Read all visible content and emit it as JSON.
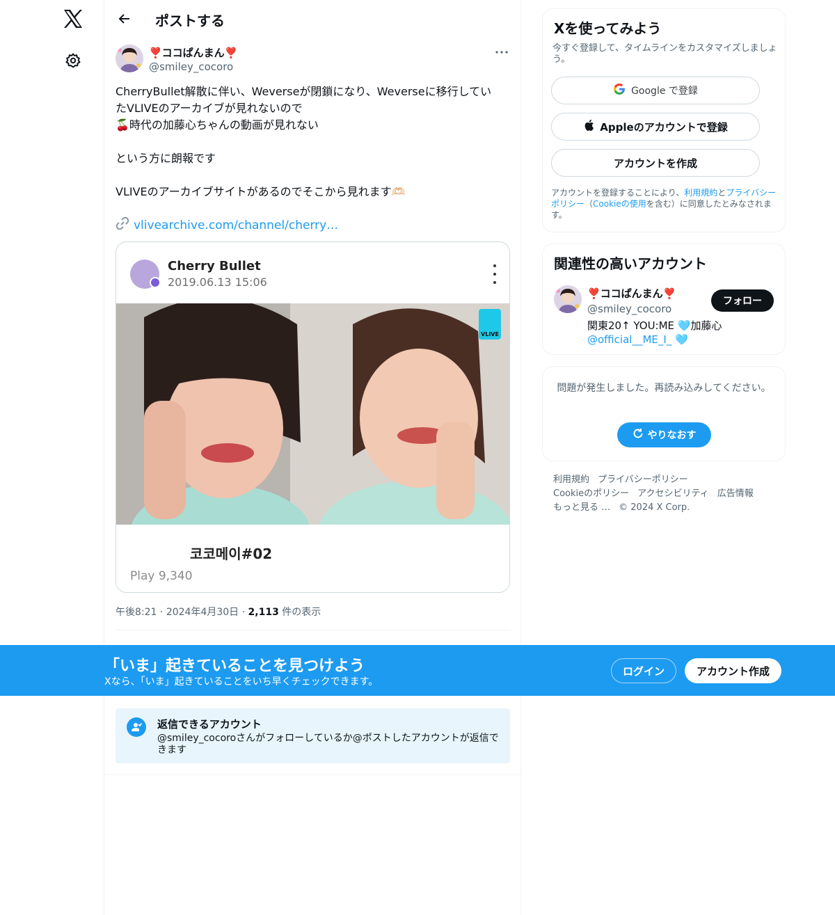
{
  "header": {
    "title": "ポストする"
  },
  "post": {
    "author_name": "❣️ココぱんまん❣️",
    "author_handle": "@smiley_cocoro",
    "text_lines": [
      "CherryBullet解散に伴い、Weverseが閉鎖になり、Weverseに移行してい",
      "たVLIVEのアーカイブが見れないので",
      "🍒時代の加藤心ちゃんの動画が見れない",
      "",
      "という方に朗報です",
      "",
      "VLIVEのアーカイブサイトがあるのでそこから見れます🫶🏻"
    ],
    "link_text": "vlivearchive.com/channel/cherry…",
    "card": {
      "channel_name": "Cherry Bullet",
      "channel_date": "2019.06.13 15:06",
      "badge_label": "VLIVE",
      "video_title": "코코메이#02",
      "plays": "Play 9,340"
    },
    "meta": {
      "time": "午後8:21",
      "date": "2024年4月30日",
      "views_count": "2,113",
      "views_label": "件の表示"
    },
    "reply_restriction": {
      "title": "返信できるアカウント",
      "description": "@smiley_cocoroさんがフォローしているか@ポストしたアカウントが返信できます"
    }
  },
  "signup_panel": {
    "title": "Xを使ってみよう",
    "subtitle": "今すぐ登録して、タイムラインをカスタマイズしましょう。",
    "google_label": "Google で登録",
    "apple_label": "Appleのアカウントで登録",
    "create_label": "アカウントを作成",
    "legal": {
      "before": "アカウントを登録することにより、",
      "terms": "利用規約",
      "and": "と",
      "privacy": "プライバシーポリシー",
      "paren_open": "（",
      "cookie": "Cookieの使用",
      "after": "を含む）に同意したとみなされます。"
    }
  },
  "related_panel": {
    "title": "関連性の高いアカウント",
    "name": "❣️ココぱんまん❣️",
    "handle": "@smiley_cocoro",
    "bio_text": "関東20↑ YOU:ME 🩵加藤心",
    "bio_mention": "@official__ME_I_",
    "bio_end": " 🩵",
    "follow_label": "フォロー"
  },
  "error_panel": {
    "message": "問題が発生しました。再読み込みしてください。",
    "retry_label": "やりなおす"
  },
  "footer": {
    "links": [
      "利用規約",
      "プライバシーポリシー",
      "Cookieのポリシー",
      "アクセシビリティ",
      "広告情報",
      "もっと見る …"
    ],
    "copyright": "© 2024 X Corp."
  },
  "banner": {
    "title": "「いま」起きていることを見つけよう",
    "subtitle": "Xなら、「いま」起きていることをいち早くチェックできます。",
    "login_label": "ログイン",
    "create_label": "アカウント作成"
  },
  "colors": {
    "accent": "#1d9bf0",
    "text": "#0f1419",
    "muted": "#536471"
  }
}
